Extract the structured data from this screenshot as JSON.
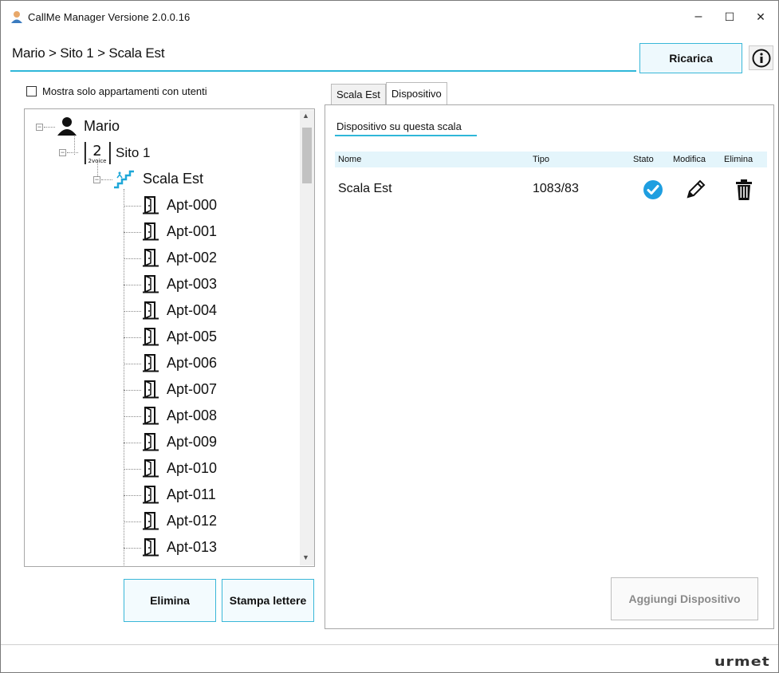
{
  "window": {
    "title": "CallMe Manager Versione 2.0.0.16",
    "minimize": "–",
    "maximize": "☐",
    "close": "✕"
  },
  "header": {
    "breadcrumb": "Mario > Sito 1 > Scala Est",
    "reload_label": "Ricarica",
    "info_icon": "info-icon"
  },
  "left": {
    "filter_label": "Mostra solo appartamenti con utenti",
    "tree": {
      "root": "Mario",
      "site": "Sito 1",
      "site_badge": "2voice",
      "stair": "Scala Est",
      "apartments": [
        "Apt-000",
        "Apt-001",
        "Apt-002",
        "Apt-003",
        "Apt-004",
        "Apt-005",
        "Apt-006",
        "Apt-007",
        "Apt-008",
        "Apt-009",
        "Apt-010",
        "Apt-011",
        "Apt-012",
        "Apt-013"
      ]
    },
    "delete_label": "Elimina",
    "print_label": "Stampa lettere"
  },
  "right": {
    "tabs": [
      {
        "label": "Scala Est",
        "active": false
      },
      {
        "label": "Dispositivo",
        "active": true
      }
    ],
    "section_title": "Dispositivo su questa scala",
    "columns": {
      "name": "Nome",
      "type": "Tipo",
      "status": "Stato",
      "edit": "Modifica",
      "delete": "Elimina"
    },
    "rows": [
      {
        "name": "Scala Est",
        "type": "1083/83",
        "status_icon": "check-circle-icon",
        "edit_icon": "pencil-icon",
        "delete_icon": "trash-icon"
      }
    ],
    "add_label": "Aggiungi Dispositivo"
  },
  "footer": {
    "brand": "urmet"
  },
  "colors": {
    "accent": "#2fb7d9",
    "status_ok": "#1e9ee0"
  }
}
